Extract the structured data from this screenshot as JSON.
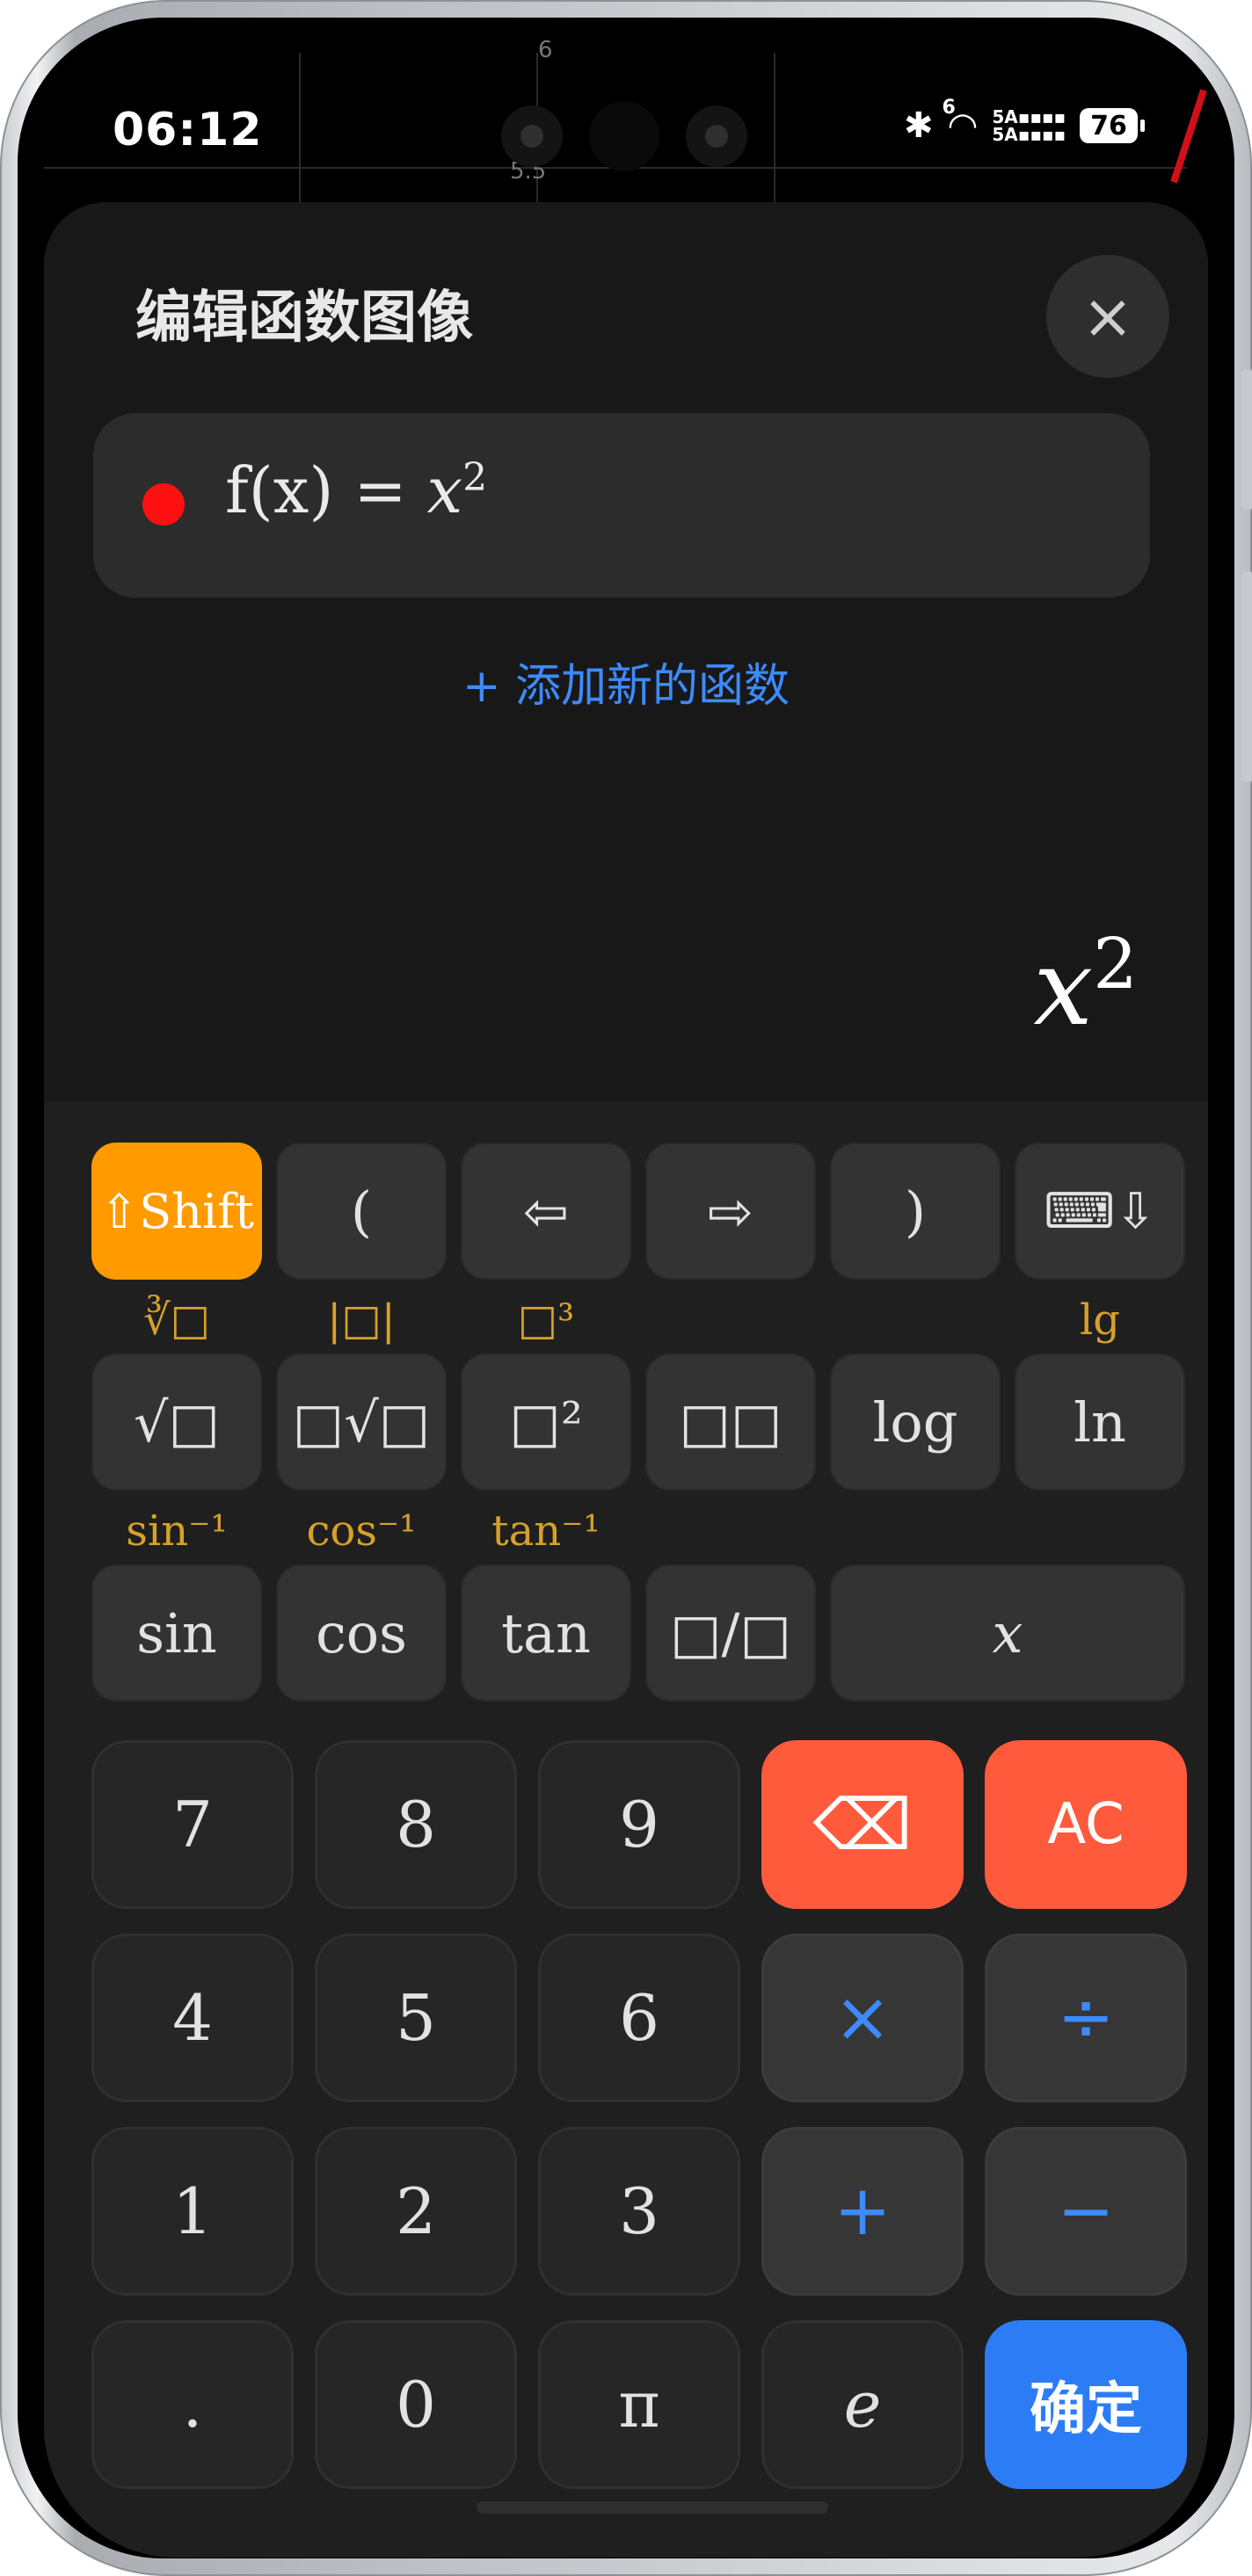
{
  "status_bar": {
    "time": "06:12",
    "network_labels": [
      "6",
      "5A",
      "5A"
    ],
    "battery": "76"
  },
  "background_graph": {
    "tick_labels": [
      "6",
      "5.5"
    ]
  },
  "dialog": {
    "title": "编辑函数图像",
    "close_label": "×"
  },
  "function": {
    "color": "#ff1010",
    "prefix": "f(x) = ",
    "variable": "x",
    "exponent": "2"
  },
  "add_function_label": "+ 添加新的函数",
  "preview": {
    "variable": "x",
    "exponent": "2"
  },
  "keyboard": {
    "row1": [
      "⇧Shift",
      "(",
      "⇦",
      "⇨",
      ")",
      "⌨⇩"
    ],
    "row2_sublabels": [
      "∛□",
      "|□|",
      "□³",
      "",
      "",
      "lg"
    ],
    "row2": [
      "√□",
      "□√□",
      "□²",
      "□□",
      "log",
      "ln"
    ],
    "row3_sublabels": [
      "sin⁻¹",
      "cos⁻¹",
      "tan⁻¹"
    ],
    "row3": [
      "sin",
      "cos",
      "tan",
      "□/□",
      "x"
    ],
    "numpad": {
      "row1": [
        "7",
        "8",
        "9",
        "⌫",
        "AC"
      ],
      "row2": [
        "4",
        "5",
        "6",
        "×",
        "÷"
      ],
      "row3": [
        "1",
        "2",
        "3",
        "+",
        "−"
      ],
      "row4": [
        ".",
        "0",
        "π",
        "e",
        "确定"
      ]
    },
    "colors": {
      "shift": "#ff9a00",
      "delete": "#ff5a3c",
      "confirm": "#2c7df5",
      "operator": "#3d8bff",
      "sublabel": "#d6a12a"
    }
  }
}
